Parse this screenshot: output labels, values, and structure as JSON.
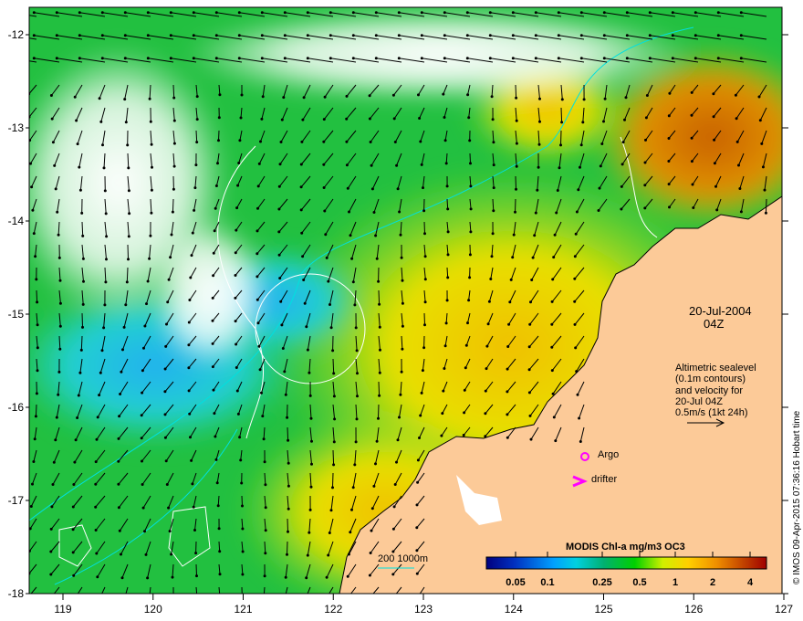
{
  "map": {
    "date": "20-Jul-2004",
    "time": "04Z",
    "legend_lines": [
      "Altimetric sealevel",
      "(0.1m contours)",
      "and velocity for",
      "20-Jul 04Z",
      "0.5m/s (1kt 24h)"
    ],
    "argo_label": "Argo",
    "drifter_label": "drifter",
    "bathymetry_label": "200  1000m",
    "stamp": "© IMOS 09-Apr-2015 07:36:16 Hobart time",
    "colors": {
      "land": "#fcca98",
      "argo": "#ff00ff",
      "contour": "#00e0e0"
    }
  },
  "colorbar": {
    "title": "MODIS Chl-a mg/m3 OC3",
    "ticks": [
      "0.05",
      "0.1",
      "0.25",
      "0.5",
      "1",
      "2",
      "4"
    ]
  },
  "axes": {
    "x_ticks": [
      "119",
      "120",
      "121",
      "122",
      "123",
      "124",
      "125",
      "126",
      "127"
    ],
    "y_ticks": [
      "-12",
      "-13",
      "-14",
      "-15",
      "-16",
      "-17",
      "-18"
    ]
  }
}
